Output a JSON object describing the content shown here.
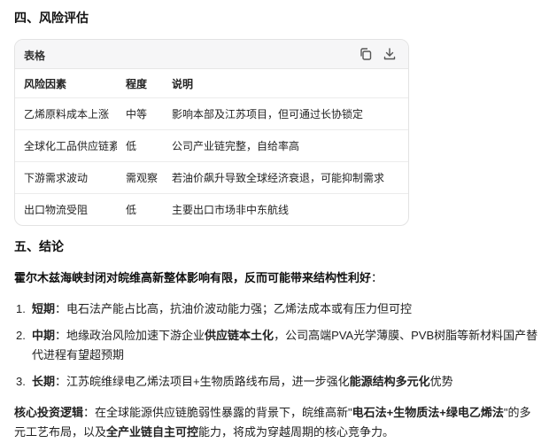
{
  "section4": {
    "title": "四、风险评估"
  },
  "table_card": {
    "label": "表格",
    "copy_icon": "copy-icon",
    "download_icon": "download-icon",
    "headers": [
      "风险因素",
      "程度",
      "说明"
    ],
    "rows": [
      [
        "乙烯原料成本上涨",
        "中等",
        "影响本部及江苏项目，但可通过长协锁定"
      ],
      [
        "全球化工品供应链紊乱",
        "低",
        "公司产业链完整，自给率高"
      ],
      [
        "下游需求波动",
        "需观察",
        "若油价飙升导致全球经济衰退，可能抑制需求"
      ],
      [
        "出口物流受阻",
        "低",
        "主要出口市场非中东航线"
      ]
    ]
  },
  "section5": {
    "title": "五、结论"
  },
  "conclusion": {
    "lead_bold": "霍尔木兹海峡封闭对皖维高新整体影响有限，反而可能带来结构性利好",
    "lead_tail": "：",
    "items": [
      {
        "num": "1.",
        "term": "短期",
        "colon": "：",
        "text": "电石法产能占比高，抗油价波动能力强；乙烯法成本或有压力但可控"
      },
      {
        "num": "2.",
        "term": "中期",
        "colon": "：",
        "pre": "地缘政治风险加速下游企业",
        "bold": "供应链本土化",
        "post": "，公司高端PVA光学薄膜、PVB树脂等新材料国产替代进程有望超预期"
      },
      {
        "num": "3.",
        "term": "长期",
        "colon": "：",
        "pre": "江苏皖维绿电乙烯法项目+生物质路线布局，进一步强化",
        "bold": "能源结构多元化",
        "post": "优势"
      }
    ],
    "core": {
      "label": "核心投资逻辑",
      "colon": "：",
      "p1": "在全球能源供应链脆弱性暴露的背景下，皖维高新\"",
      "b1": "电石法+生物质法+绿电乙烯法",
      "p2": "\"的多元工艺布局，以及",
      "b2": "全产业链自主可控",
      "p3": "能力，将成为穿越周期的核心竞争力。"
    }
  }
}
